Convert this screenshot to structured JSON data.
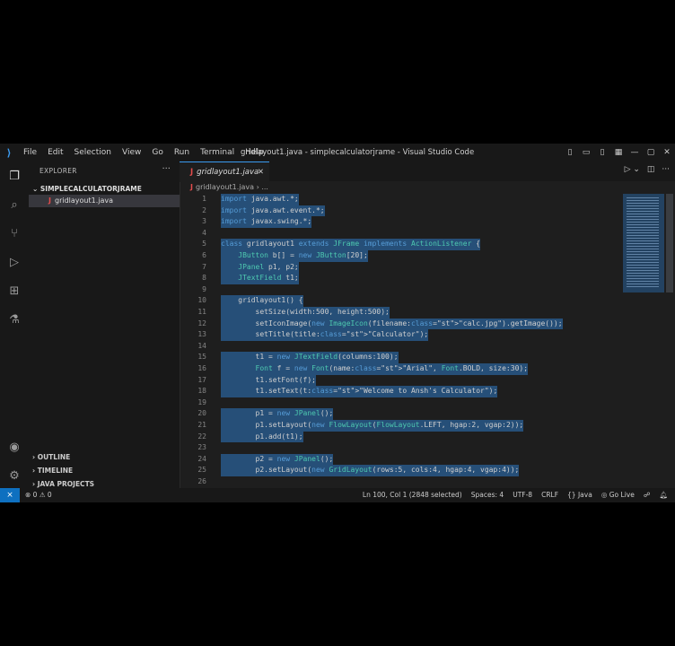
{
  "titlebar": {
    "menu": [
      "File",
      "Edit",
      "Selection",
      "View",
      "Go",
      "Run",
      "Terminal",
      "Help"
    ],
    "title": "gridlayout1.java - simplecalculatorjrame - Visual Studio Code",
    "controls": [
      "—",
      "▢",
      "✕"
    ]
  },
  "sidebar": {
    "header": "EXPLORER",
    "more": "···",
    "folder": "SIMPLECALCULATORJRAME",
    "file": "gridlayout1.java",
    "file_icon": "J",
    "sections": [
      "OUTLINE",
      "TIMELINE",
      "JAVA PROJECTS"
    ]
  },
  "tab": {
    "label": "gridlayout1.java",
    "icon": "J",
    "close": "✕"
  },
  "breadcrumb": {
    "file": "gridlayout1.java",
    "sep": "›",
    "more": "..."
  },
  "code": {
    "line_numbers": [
      "1",
      "2",
      "3",
      "4",
      "5",
      "6",
      "7",
      "8",
      "9",
      "10",
      "11",
      "12",
      "13",
      "14",
      "15",
      "16",
      "17",
      "18",
      "19",
      "20",
      "21",
      "22",
      "23",
      "24",
      "25",
      "26"
    ],
    "lines": [
      "import java.awt.*;",
      "import java.awt.event.*;",
      "import javax.swing.*;",
      "",
      "class gridlayout1 extends JFrame implements ActionListener {",
      "    JButton b[] = new JButton[20];",
      "    JPanel p1, p2;",
      "    JTextField t1;",
      "",
      "    gridlayout1() {",
      "        setSize(width:500, height:500);",
      "        setIconImage(new ImageIcon(filename:\"calc.jpg\").getImage());",
      "        setTitle(title:\"Calculator\");",
      "",
      "        t1 = new JTextField(columns:100);",
      "        Font f = new Font(name:\"Arial\", Font.BOLD, size:30);",
      "        t1.setFont(f);",
      "        t1.setText(t:\"Welcome to Ansh's Calculator\");",
      "",
      "        p1 = new JPanel();",
      "        p1.setLayout(new FlowLayout(FlowLayout.LEFT, hgap:2, vgap:2));",
      "        p1.add(t1);",
      "",
      "        p2 = new JPanel();",
      "        p2.setLayout(new GridLayout(rows:5, cols:4, hgap:4, vgap:4));",
      ""
    ]
  },
  "statusbar": {
    "errors": "⊗ 0 ⚠ 0",
    "position": "Ln 100, Col 1 (2848 selected)",
    "spaces": "Spaces: 4",
    "encoding": "UTF-8",
    "eol": "CRLF",
    "language": "{} Java",
    "golive": "Go Live"
  },
  "colors": {
    "accent": "#0e70c0",
    "selection": "#264f78",
    "java_icon": "#e34c4c"
  }
}
